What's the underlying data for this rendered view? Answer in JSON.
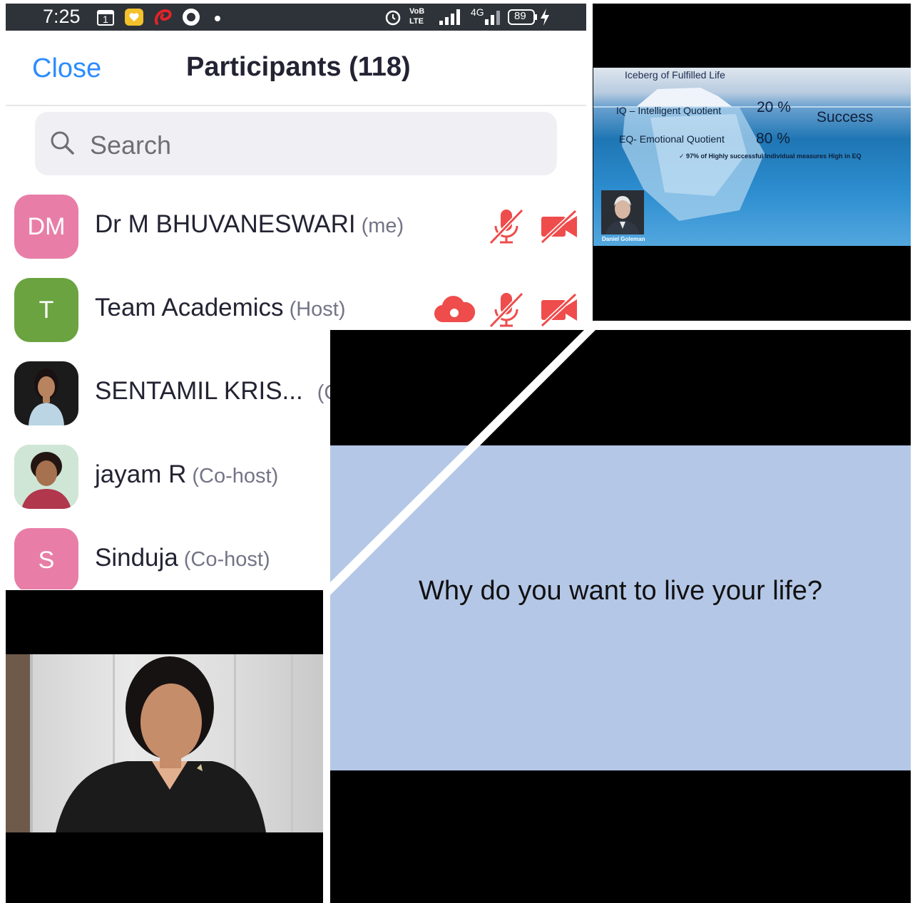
{
  "status_bar": {
    "time": "7:25",
    "calendar_day": "1",
    "volte_label": "VoB LTE",
    "network_label": "4G",
    "battery": "89"
  },
  "panel": {
    "close_label": "Close",
    "title": "Participants (118)",
    "search_placeholder": "Search"
  },
  "participants": [
    {
      "initials": "DM",
      "name": "Dr M BHUVANESWARI",
      "role": "(me)",
      "avatar_color": "#e87ea7"
    },
    {
      "initials": "T",
      "name": "Team Academics",
      "role": "(Host)",
      "avatar_color": "#6aa33f"
    },
    {
      "initials": "",
      "name": "SENTAMIL KRIS...",
      "role": "(Co-host)",
      "avatar_color": "#d9d2cc"
    },
    {
      "initials": "",
      "name": "jayam R",
      "role": "(Co-host)",
      "avatar_color": "#c9a57e"
    },
    {
      "initials": "S",
      "name": "Sinduja",
      "role": "(Co-host)",
      "avatar_color": "#e87ea7"
    }
  ],
  "colors": {
    "accent_blue": "#2d8cff",
    "icon_red": "#ef4c4c",
    "mic_green": "#36c64a"
  },
  "slide1": {
    "title": "Iceberg of Fulfilled Life",
    "iq_label": "IQ – Intelligent Quotient",
    "iq_value": "20 %",
    "success_label": "Success",
    "eq_label": "EQ- Emotional Quotient",
    "eq_value": "80 %",
    "note": "✓ 97% of Highly successful Individual measures High in EQ",
    "portrait_caption": "Daniel Goleman"
  },
  "slide2": {
    "text": "Why do you want to live your life?"
  }
}
